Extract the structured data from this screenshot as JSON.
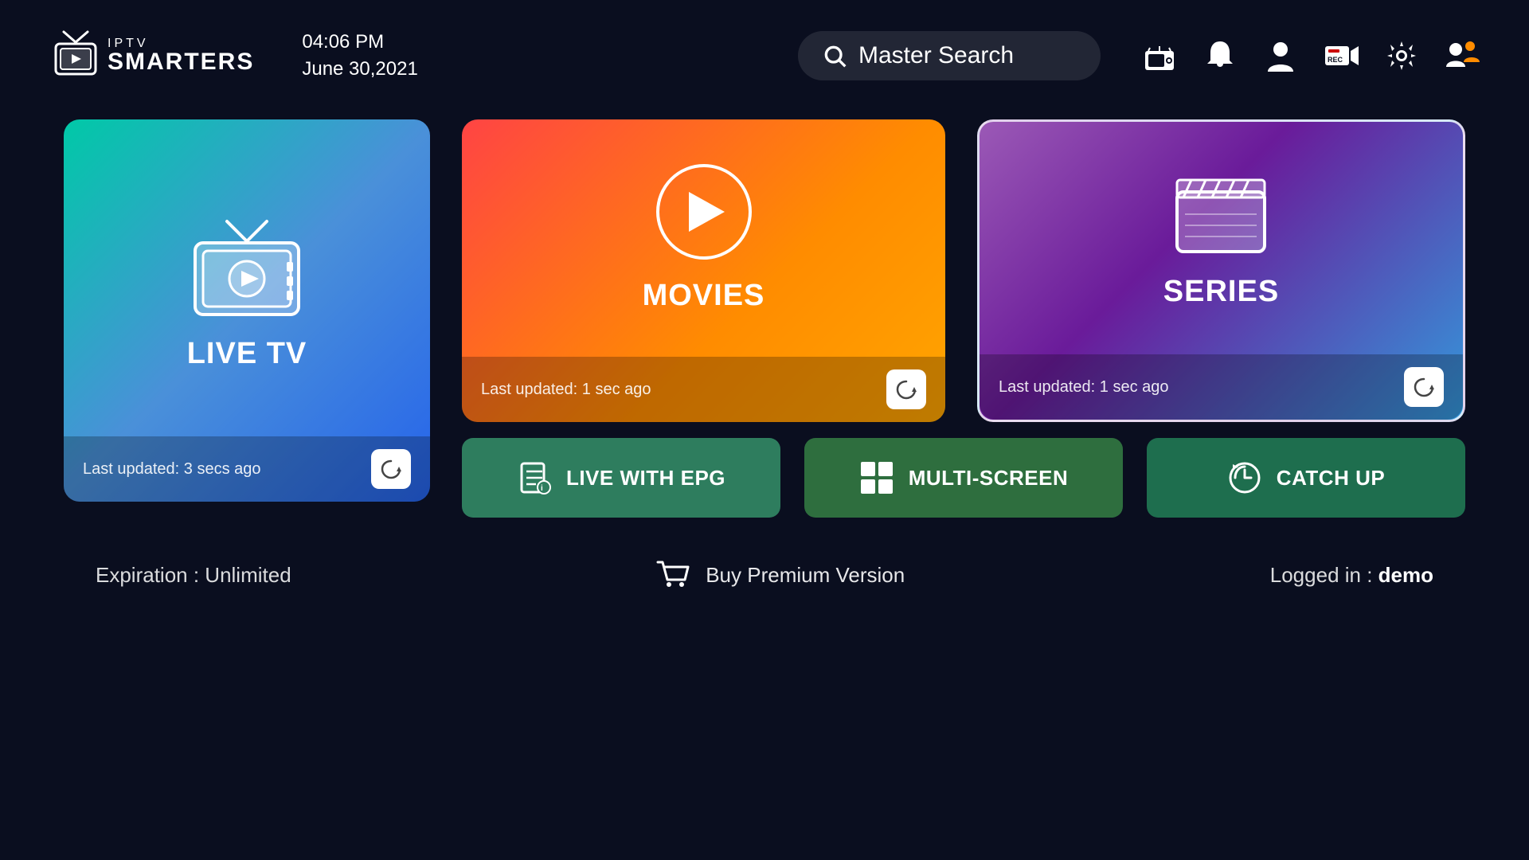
{
  "header": {
    "logo_iptv": "IPTV",
    "logo_smarters": "SMARTERS",
    "time": "04:06 PM",
    "date": "June 30,2021",
    "search_placeholder": "Master Search"
  },
  "cards": {
    "live_tv": {
      "title": "LIVE TV",
      "last_updated": "Last updated: 3 secs ago"
    },
    "movies": {
      "title": "MOVIES",
      "last_updated": "Last updated: 1 sec ago"
    },
    "series": {
      "title": "SERIES",
      "last_updated": "Last updated: 1 sec ago"
    }
  },
  "buttons": {
    "live_epg": "LIVE WITH EPG",
    "multiscreen": "MULTI-SCREEN",
    "catchup": "CATCH UP"
  },
  "footer": {
    "expiration": "Expiration : Unlimited",
    "buy_premium": "Buy Premium Version",
    "logged_in_label": "Logged in : ",
    "logged_in_user": "demo"
  }
}
